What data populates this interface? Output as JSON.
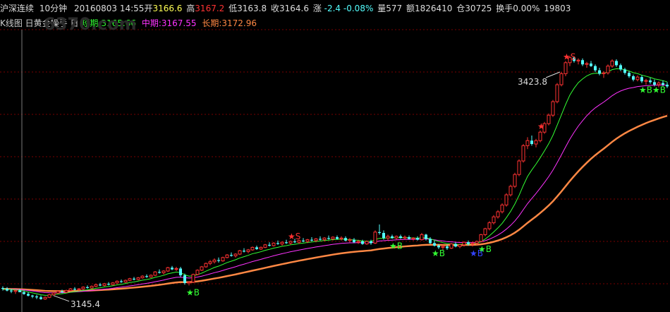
{
  "header": {
    "symbol": "沪深连续",
    "period": "10分钟",
    "datetime": "20160803  14:55",
    "open_label": "开",
    "open": "3166.6",
    "high_label": "高",
    "high": "3167.2",
    "low_label": "低",
    "low": "3163.8",
    "close_label": "收",
    "close": "3164.6",
    "change_label": "涨",
    "change": "-2.4",
    "change_pct": "-0.08%",
    "volume_label": "量",
    "volume": "577",
    "amount_label": "额",
    "amount": "1826410",
    "oi_label": "仓",
    "oi": "30725",
    "turnover_label": "换手",
    "turnover": "0.00%",
    "extra": "19803"
  },
  "indicator": {
    "name": "K线图 日黄金操手 日",
    "short_label": "短期:",
    "short_value": "3165.66",
    "mid_label": "中期:",
    "mid_value": "3167.55",
    "long_label": "长期:",
    "long_value": "3172.96",
    "watermark": "6370.com"
  },
  "colors": {
    "up": "#ff3232",
    "down": "#54ffff",
    "short_ma": "#33ff33",
    "mid_ma": "#ff33ff",
    "long_ma": "#ff8844",
    "grid": "#7a0000",
    "buy": "#33ff33",
    "buy_alt": "#3344ff",
    "sell": "#ff3232",
    "header_date": "#dddddd",
    "header_value_up": "#ff3232",
    "header_value_dn": "#33ff33",
    "header_value": "#ffff55"
  },
  "chart_data": {
    "type": "candlestick",
    "y_range": [
      3140,
      3440
    ],
    "candles": [
      [
        3150,
        3152,
        3147,
        3149
      ],
      [
        3149,
        3151,
        3146,
        3147
      ],
      [
        3147,
        3149,
        3144,
        3146
      ],
      [
        3146,
        3148,
        3143,
        3147
      ],
      [
        3147,
        3149,
        3145,
        3145
      ],
      [
        3145,
        3147,
        3142,
        3143
      ],
      [
        3143,
        3145,
        3140,
        3141
      ],
      [
        3141,
        3142,
        3138,
        3140
      ],
      [
        3140,
        3142,
        3137,
        3139
      ],
      [
        3139,
        3141,
        3136,
        3137
      ],
      [
        3137,
        3140,
        3136,
        3139
      ],
      [
        3139,
        3143,
        3138,
        3142
      ],
      [
        3142,
        3145,
        3141,
        3144
      ],
      [
        3144,
        3147,
        3143,
        3146
      ],
      [
        3146,
        3148,
        3144,
        3145
      ],
      [
        3145,
        3148,
        3144,
        3147
      ],
      [
        3147,
        3150,
        3146,
        3149
      ],
      [
        3149,
        3151,
        3147,
        3148
      ],
      [
        3148,
        3150,
        3146,
        3149
      ],
      [
        3149,
        3152,
        3148,
        3151
      ],
      [
        3151,
        3153,
        3149,
        3150
      ],
      [
        3150,
        3153,
        3149,
        3152
      ],
      [
        3152,
        3155,
        3151,
        3154
      ],
      [
        3154,
        3156,
        3152,
        3153
      ],
      [
        3153,
        3156,
        3152,
        3155
      ],
      [
        3155,
        3157,
        3153,
        3154
      ],
      [
        3154,
        3157,
        3153,
        3156
      ],
      [
        3156,
        3159,
        3155,
        3158
      ],
      [
        3158,
        3160,
        3156,
        3157
      ],
      [
        3157,
        3160,
        3156,
        3159
      ],
      [
        3159,
        3162,
        3158,
        3161
      ],
      [
        3161,
        3163,
        3159,
        3160
      ],
      [
        3160,
        3163,
        3159,
        3162
      ],
      [
        3162,
        3165,
        3161,
        3164
      ],
      [
        3164,
        3166,
        3162,
        3163
      ],
      [
        3163,
        3166,
        3162,
        3165
      ],
      [
        3165,
        3170,
        3164,
        3169
      ],
      [
        3169,
        3172,
        3167,
        3168
      ],
      [
        3168,
        3171,
        3166,
        3170
      ],
      [
        3170,
        3175,
        3169,
        3174
      ],
      [
        3174,
        3176,
        3171,
        3172
      ],
      [
        3172,
        3175,
        3170,
        3173
      ],
      [
        3173,
        3175,
        3163,
        3165
      ],
      [
        3165,
        3167,
        3154,
        3156
      ],
      [
        3156,
        3158,
        3153,
        3157
      ],
      [
        3157,
        3167,
        3156,
        3166
      ],
      [
        3166,
        3172,
        3165,
        3171
      ],
      [
        3171,
        3176,
        3170,
        3175
      ],
      [
        3175,
        3180,
        3174,
        3179
      ],
      [
        3179,
        3183,
        3177,
        3181
      ],
      [
        3181,
        3185,
        3179,
        3183
      ],
      [
        3183,
        3186,
        3180,
        3182
      ],
      [
        3182,
        3187,
        3181,
        3186
      ],
      [
        3186,
        3190,
        3185,
        3189
      ],
      [
        3189,
        3192,
        3187,
        3188
      ],
      [
        3188,
        3191,
        3186,
        3190
      ],
      [
        3190,
        3195,
        3189,
        3194
      ],
      [
        3194,
        3197,
        3192,
        3193
      ],
      [
        3193,
        3196,
        3191,
        3195
      ],
      [
        3195,
        3199,
        3194,
        3198
      ],
      [
        3198,
        3200,
        3195,
        3196
      ],
      [
        3196,
        3199,
        3195,
        3198
      ],
      [
        3198,
        3202,
        3197,
        3201
      ],
      [
        3201,
        3204,
        3199,
        3200
      ],
      [
        3200,
        3204,
        3199,
        3203
      ],
      [
        3203,
        3206,
        3201,
        3202
      ],
      [
        3202,
        3205,
        3200,
        3204
      ],
      [
        3204,
        3207,
        3202,
        3203
      ],
      [
        3203,
        3206,
        3201,
        3205
      ],
      [
        3205,
        3208,
        3203,
        3204
      ],
      [
        3204,
        3207,
        3202,
        3206
      ],
      [
        3206,
        3209,
        3204,
        3205
      ],
      [
        3205,
        3208,
        3203,
        3207
      ],
      [
        3207,
        3210,
        3205,
        3206
      ],
      [
        3206,
        3209,
        3204,
        3208
      ],
      [
        3208,
        3211,
        3206,
        3207
      ],
      [
        3207,
        3210,
        3205,
        3209
      ],
      [
        3209,
        3212,
        3207,
        3208
      ],
      [
        3208,
        3211,
        3206,
        3210
      ],
      [
        3210,
        3212,
        3207,
        3208
      ],
      [
        3208,
        3211,
        3206,
        3209
      ],
      [
        3209,
        3211,
        3205,
        3206
      ],
      [
        3206,
        3209,
        3204,
        3207
      ],
      [
        3207,
        3209,
        3203,
        3204
      ],
      [
        3204,
        3207,
        3202,
        3205
      ],
      [
        3205,
        3207,
        3201,
        3202
      ],
      [
        3202,
        3206,
        3201,
        3205
      ],
      [
        3205,
        3207,
        3201,
        3203
      ],
      [
        3203,
        3218,
        3202,
        3216
      ],
      [
        3216,
        3225,
        3213,
        3215
      ],
      [
        3215,
        3218,
        3207,
        3209
      ],
      [
        3209,
        3213,
        3206,
        3211
      ],
      [
        3211,
        3213,
        3208,
        3209
      ],
      [
        3209,
        3212,
        3207,
        3211
      ],
      [
        3211,
        3213,
        3208,
        3209
      ],
      [
        3209,
        3212,
        3207,
        3210
      ],
      [
        3210,
        3212,
        3207,
        3208
      ],
      [
        3208,
        3210,
        3206,
        3209
      ],
      [
        3209,
        3211,
        3206,
        3207
      ],
      [
        3207,
        3215,
        3206,
        3213
      ],
      [
        3213,
        3214,
        3206,
        3208
      ],
      [
        3208,
        3210,
        3202,
        3203
      ],
      [
        3203,
        3206,
        3199,
        3200
      ],
      [
        3200,
        3202,
        3196,
        3198
      ],
      [
        3198,
        3201,
        3195,
        3199
      ],
      [
        3199,
        3201,
        3195,
        3197
      ],
      [
        3197,
        3203,
        3196,
        3202
      ],
      [
        3202,
        3204,
        3198,
        3199
      ],
      [
        3199,
        3202,
        3197,
        3201
      ],
      [
        3201,
        3205,
        3199,
        3204
      ],
      [
        3204,
        3206,
        3200,
        3202
      ],
      [
        3202,
        3205,
        3199,
        3203
      ],
      [
        3203,
        3206,
        3201,
        3205
      ],
      [
        3205,
        3214,
        3204,
        3213
      ],
      [
        3213,
        3221,
        3211,
        3220
      ],
      [
        3220,
        3229,
        3218,
        3227
      ],
      [
        3227,
        3236,
        3225,
        3234
      ],
      [
        3234,
        3242,
        3232,
        3240
      ],
      [
        3240,
        3250,
        3238,
        3248
      ],
      [
        3248,
        3262,
        3246,
        3260
      ],
      [
        3260,
        3272,
        3258,
        3270
      ],
      [
        3270,
        3286,
        3268,
        3284
      ],
      [
        3284,
        3302,
        3282,
        3300
      ],
      [
        3300,
        3320,
        3298,
        3318
      ],
      [
        3318,
        3328,
        3314,
        3324
      ],
      [
        3324,
        3330,
        3318,
        3320
      ],
      [
        3320,
        3326,
        3316,
        3324
      ],
      [
        3324,
        3336,
        3322,
        3334
      ],
      [
        3334,
        3346,
        3332,
        3344
      ],
      [
        3344,
        3356,
        3342,
        3354
      ],
      [
        3354,
        3372,
        3352,
        3370
      ],
      [
        3370,
        3392,
        3368,
        3390
      ],
      [
        3390,
        3405,
        3388,
        3403
      ],
      [
        3403,
        3418,
        3400,
        3416
      ],
      [
        3416,
        3424,
        3412,
        3422
      ],
      [
        3422,
        3423,
        3416,
        3418
      ],
      [
        3418,
        3421,
        3414,
        3419
      ],
      [
        3419,
        3421,
        3412,
        3414
      ],
      [
        3414,
        3417,
        3410,
        3415
      ],
      [
        3415,
        3418,
        3411,
        3412
      ],
      [
        3412,
        3414,
        3405,
        3407
      ],
      [
        3407,
        3410,
        3401,
        3403
      ],
      [
        3403,
        3406,
        3398,
        3404
      ],
      [
        3404,
        3414,
        3402,
        3412
      ],
      [
        3412,
        3420,
        3410,
        3418
      ],
      [
        3418,
        3420,
        3411,
        3413
      ],
      [
        3413,
        3415,
        3406,
        3408
      ],
      [
        3408,
        3410,
        3402,
        3404
      ],
      [
        3404,
        3406,
        3398,
        3400
      ],
      [
        3400,
        3402,
        3394,
        3396
      ],
      [
        3396,
        3401,
        3394,
        3399
      ],
      [
        3399,
        3401,
        3392,
        3394
      ],
      [
        3394,
        3397,
        3390,
        3395
      ],
      [
        3395,
        3398,
        3391,
        3393
      ],
      [
        3393,
        3396,
        3388,
        3390
      ],
      [
        3390,
        3394,
        3387,
        3392
      ],
      [
        3392,
        3395,
        3388,
        3390
      ],
      [
        3390,
        3393,
        3386,
        3388
      ]
    ],
    "labels": [
      {
        "index": 12,
        "text": "3145.4",
        "kind": "low"
      },
      {
        "index": 132,
        "text": "3423.8",
        "kind": "high"
      }
    ],
    "signals": [
      {
        "index": 44,
        "text": "★B",
        "color_key": "buy"
      },
      {
        "index": 68,
        "text": "★S",
        "color_key": "sell"
      },
      {
        "index": 92,
        "text": "★B",
        "color_key": "buy"
      },
      {
        "index": 102,
        "text": "★B",
        "color_key": "buy"
      },
      {
        "index": 111,
        "text": "★B",
        "color_key": "buy_alt"
      },
      {
        "index": 113,
        "text": "★B",
        "color_key": "buy"
      },
      {
        "index": 127,
        "text": "★",
        "color_key": "sell"
      },
      {
        "index": 133,
        "text": "★S",
        "color_key": "sell"
      },
      {
        "index": 151,
        "text": "★B★B",
        "color_key": "buy"
      }
    ]
  }
}
